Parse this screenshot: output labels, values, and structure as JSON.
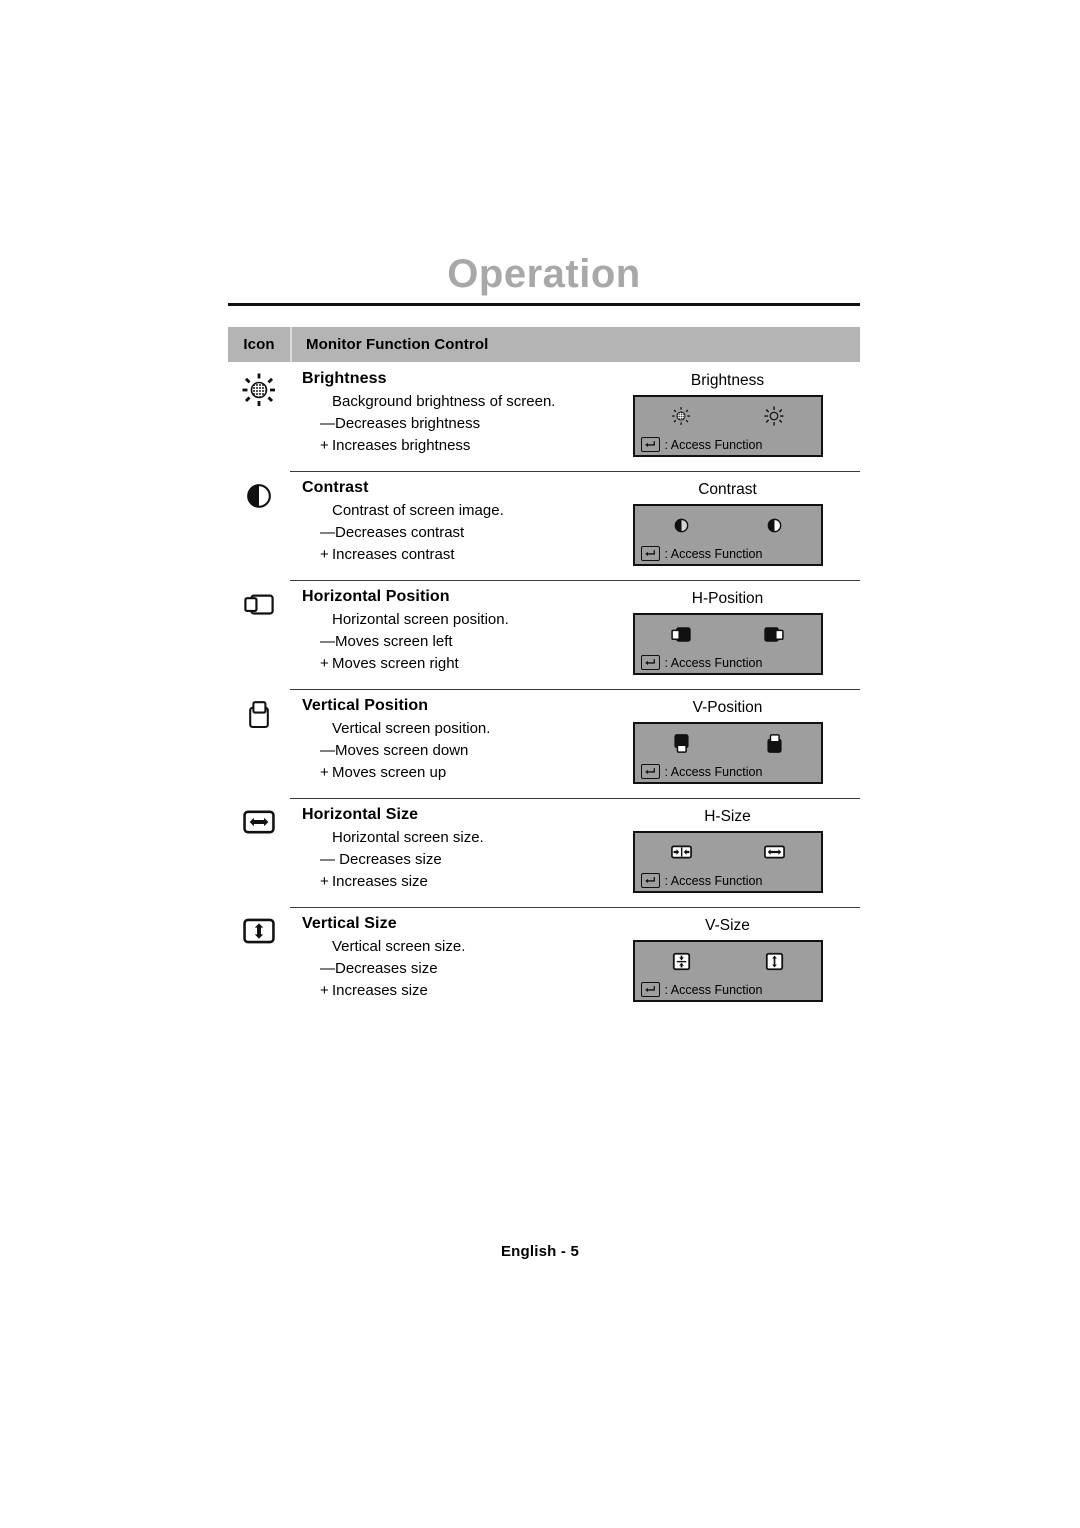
{
  "page": {
    "title": "Operation",
    "footer": "English - 5",
    "accent_gray": "#a8a8a8",
    "header_bar_color": "#b4b4b4",
    "osd_box_color": "#9e9e9e"
  },
  "table": {
    "columns": {
      "icon": "Icon",
      "description": "Monitor Function Control"
    },
    "rows": [
      {
        "icon": "brightness-icon",
        "name": "Brightness",
        "lines": [
          {
            "sign": "",
            "text": "Background brightness of screen."
          },
          {
            "sign": "—",
            "text": "Decreases brightness"
          },
          {
            "sign": "+",
            "text": "Increases brightness"
          }
        ],
        "osd": {
          "label": "Brightness",
          "left_icon": "brightness-low-icon",
          "right_icon": "brightness-high-icon",
          "footer": ":  Access Function",
          "footer_key": "enter-key-icon"
        }
      },
      {
        "icon": "contrast-icon",
        "name": "Contrast",
        "lines": [
          {
            "sign": "",
            "text": "Contrast of screen image."
          },
          {
            "sign": "—",
            "text": "Decreases contrast"
          },
          {
            "sign": "+",
            "text": "Increases contrast"
          }
        ],
        "osd": {
          "label": "Contrast",
          "left_icon": "contrast-low-icon",
          "right_icon": "contrast-high-icon",
          "footer": ":  Access Function",
          "footer_key": "enter-key-icon"
        }
      },
      {
        "icon": "h-position-icon",
        "name": "Horizontal Position",
        "lines": [
          {
            "sign": "",
            "text": "Horizontal screen position."
          },
          {
            "sign": "—",
            "text": "Moves screen left"
          },
          {
            "sign": "+",
            "text": "Moves screen right"
          }
        ],
        "osd": {
          "label": "H-Position",
          "left_icon": "h-position-left-icon",
          "right_icon": "h-position-right-icon",
          "footer": ":  Access Function",
          "footer_key": "enter-key-icon"
        }
      },
      {
        "icon": "v-position-icon",
        "name": "Vertical Position",
        "lines": [
          {
            "sign": "",
            "text": "Vertical screen position."
          },
          {
            "sign": "—",
            "text": "Moves screen down"
          },
          {
            "sign": "+",
            "text": "Moves screen up"
          }
        ],
        "osd": {
          "label": "V-Position",
          "left_icon": "v-position-down-icon",
          "right_icon": "v-position-up-icon",
          "footer": ":  Access Function",
          "footer_key": "enter-key-icon"
        }
      },
      {
        "icon": "h-size-icon",
        "name": "Horizontal Size",
        "lines": [
          {
            "sign": "",
            "text": "Horizontal screen size."
          },
          {
            "sign": "—",
            "text": " Decreases size"
          },
          {
            "sign": "+",
            "text": "Increases size"
          }
        ],
        "osd": {
          "label": "H-Size",
          "left_icon": "h-size-decrease-icon",
          "right_icon": "h-size-increase-icon",
          "footer": ":  Access Function",
          "footer_key": "enter-key-icon"
        }
      },
      {
        "icon": "v-size-icon",
        "name": "Vertical Size",
        "lines": [
          {
            "sign": "",
            "text": "Vertical screen size."
          },
          {
            "sign": "—",
            "text": "Decreases size"
          },
          {
            "sign": "+",
            "text": "Increases size"
          }
        ],
        "osd": {
          "label": "V-Size",
          "left_icon": "v-size-decrease-icon",
          "right_icon": "v-size-increase-icon",
          "footer": ":  Access Function",
          "footer_key": "enter-key-icon"
        }
      }
    ]
  }
}
